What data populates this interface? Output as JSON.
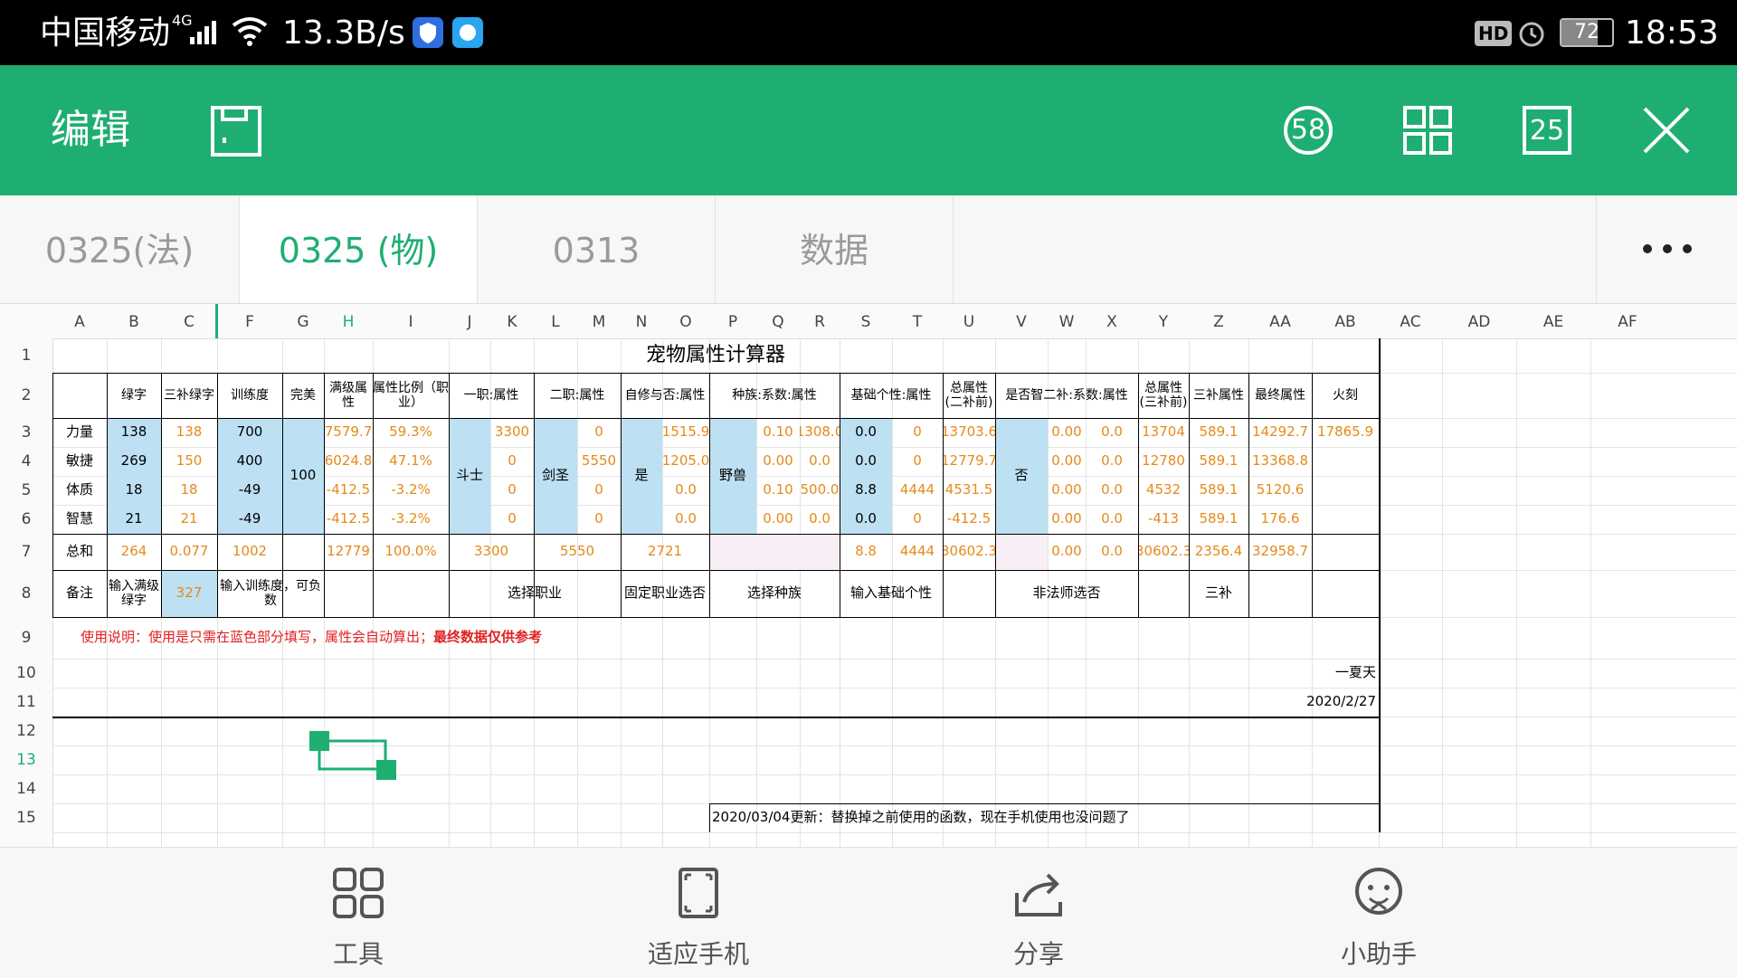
{
  "status_bar": {
    "carrier": "中国移动",
    "network": "4G",
    "speed": "13.3B/s",
    "hd": "HD",
    "battery": "72",
    "time": "18:53"
  },
  "title_bar": {
    "title": "编辑",
    "badge_count": "58",
    "sheet_count": "25"
  },
  "tabs": [
    "0325(法)",
    "0325 (物)",
    "0313",
    "数据"
  ],
  "active_tab": 1,
  "columns": [
    "A",
    "B",
    "C",
    "F",
    "G",
    "H",
    "I",
    "J",
    "K",
    "L",
    "M",
    "N",
    "O",
    "P",
    "Q",
    "R",
    "S",
    "T",
    "U",
    "V",
    "W",
    "X",
    "Y",
    "Z",
    "AA",
    "AB",
    "AC",
    "AD",
    "AE",
    "AF"
  ],
  "rows": [
    "1",
    "2",
    "3",
    "4",
    "5",
    "6",
    "7",
    "8",
    "9",
    "10",
    "11",
    "12",
    "13",
    "14",
    "15"
  ],
  "sheet": {
    "title": "宠物属性计算器",
    "headers": [
      "绿字",
      "三补绿字",
      "训练度",
      "完美",
      "满级属性",
      "属性比例（职业）",
      "一职:属性",
      "二职:属性",
      "自修与否:属性",
      "种族:系数:属性",
      "基础个性:属性",
      "总属性(二补前)",
      "是否智二补:系数:属性",
      "总属性(三补前)",
      "三补属性",
      "最终属性",
      "火刻"
    ],
    "row_labels": [
      "力量",
      "敏捷",
      "体质",
      "智慧",
      "总和",
      "备注"
    ],
    "values": {
      "B": [
        "138",
        "269",
        "18",
        "21",
        "264"
      ],
      "C": [
        "138",
        "150",
        "18",
        "21",
        "0.077"
      ],
      "F": [
        "700",
        "400",
        "-49",
        "-49",
        "1002"
      ],
      "G_merged": "100",
      "H": [
        "7579.7",
        "6024.8",
        "-412.5",
        "-412.5",
        "12779"
      ],
      "I": [
        "59.3%",
        "47.1%",
        "-3.2%",
        "-3.2%",
        "100.0%"
      ],
      "J_merged": "斗士",
      "K": [
        "3300",
        "0",
        "0",
        "0"
      ],
      "JK_total": "3300",
      "L_merged": "剑圣",
      "M": [
        "0",
        "5550",
        "0",
        "0"
      ],
      "LM_total": "5550",
      "N_merged": "是",
      "O": [
        "1515.9",
        "1205.0",
        "0.0",
        "0.0"
      ],
      "NO_total": "2721",
      "P_merged": "野兽",
      "Q": [
        "0.10",
        "0.00",
        "0.10",
        "0.00"
      ],
      "R": [
        "1308.0",
        "0.0",
        "500.0",
        "0.0"
      ],
      "S": [
        "0.0",
        "0.0",
        "8.8",
        "0.0",
        "8.8"
      ],
      "T": [
        "0",
        "0",
        "4444",
        "0",
        "4444"
      ],
      "U": [
        "13703.6",
        "12779.7",
        "4531.5",
        "-412.5",
        "30602.3"
      ],
      "V_merged": "否",
      "W": [
        "0.00",
        "0.00",
        "0.00",
        "0.00",
        "0.00"
      ],
      "X": [
        "0.0",
        "0.0",
        "0.0",
        "0.0",
        "0.0"
      ],
      "Y": [
        "13704",
        "12780",
        "4532",
        "-413",
        "30602.3"
      ],
      "Z": [
        "589.1",
        "589.1",
        "589.1",
        "589.1",
        "2356.4"
      ],
      "AA": [
        "14292.7",
        "13368.8",
        "5120.6",
        "176.6",
        "32958.7"
      ],
      "AB": [
        "17865.9",
        "",
        "",
        "",
        ""
      ]
    },
    "notes_row": {
      "B": "输入满级绿字",
      "C": "327",
      "F": "输入训练度，可负数",
      "JK": "选择职业",
      "NO": "固定职业选否",
      "PR": "选择种族",
      "ST": "输入基础个性",
      "VX": "非法师选否",
      "Z": "三补"
    },
    "instruction": "使用说明：使用是只需在蓝色部分填写，属性会自动算出；",
    "instruction_bold": "最终数据仅供参考",
    "author": "一夏天",
    "date": "2020/2/27",
    "update_note": "2020/03/04更新：替换掉之前使用的函数，现在手机使用也没问题了"
  },
  "bottom_bar": [
    "工具",
    "适应手机",
    "分享",
    "小助手"
  ],
  "colors": {
    "accent_green": "#1fae72",
    "input_blue": "#bde0f3",
    "orange_value": "#e48a1a",
    "instruction_red": "#e02020"
  }
}
